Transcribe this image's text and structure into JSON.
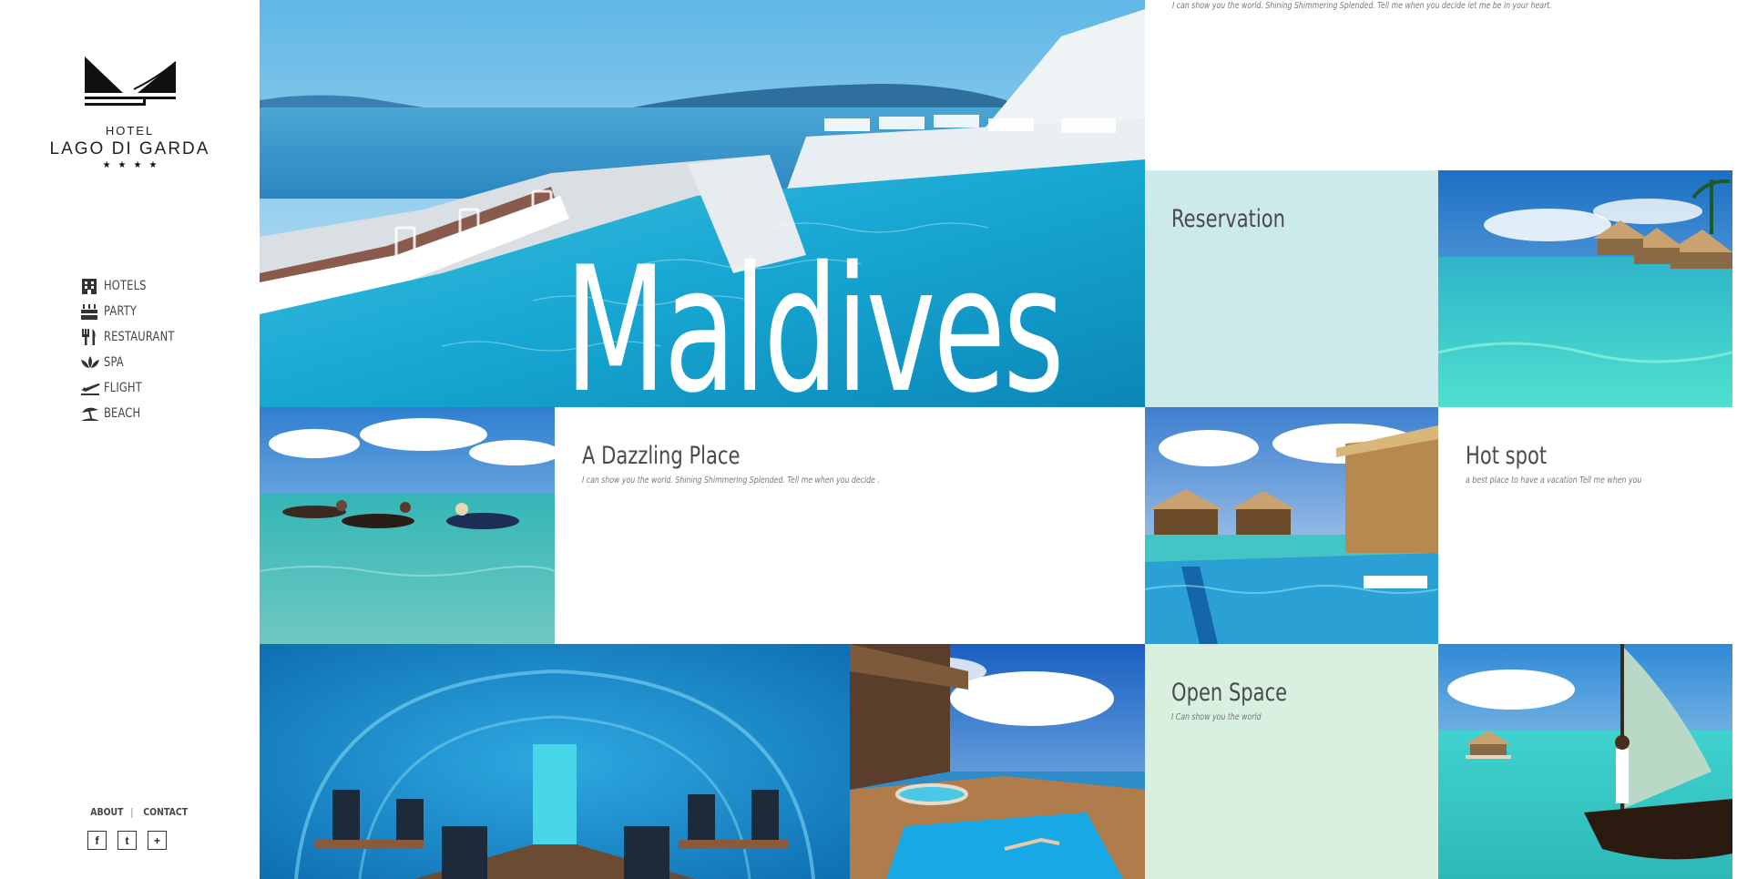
{
  "brand": {
    "line1": "HOTEL",
    "line2": "LAGO DI GARDA",
    "stars": "★★★★"
  },
  "nav": [
    {
      "label": "HOTELS",
      "icon": "building-icon"
    },
    {
      "label": "PARTY",
      "icon": "cake-icon"
    },
    {
      "label": "RESTAURANT",
      "icon": "fork-knife-icon"
    },
    {
      "label": "SPA",
      "icon": "lotus-icon"
    },
    {
      "label": "FLIGHT",
      "icon": "plane-icon"
    },
    {
      "label": "BEACH",
      "icon": "umbrella-icon"
    }
  ],
  "footer": {
    "about": "ABOUT",
    "separator": "|",
    "contact": "CONTACT"
  },
  "social": [
    {
      "glyph": "f",
      "icon": "facebook-icon"
    },
    {
      "glyph": "t",
      "icon": "twitter-icon"
    },
    {
      "glyph": "+",
      "icon": "plus-icon"
    }
  ],
  "hero": {
    "title": "Maldives"
  },
  "top_text": "I can show you the world. Shining Shimmering Splended. Tell me when you decide let me be in your heart.",
  "tiles": {
    "reservation": {
      "title": "Reservation"
    },
    "dazzling": {
      "title": "A Dazzling Place",
      "subtitle": "I can show you the world. Shining Shimmering Splended. Tell me when you decide ."
    },
    "hotspot": {
      "title": "Hot spot",
      "subtitle": "a best place to have a vacation Tell me when you"
    },
    "openspace": {
      "title": "Open Space",
      "subtitle": "I Can show you the world"
    }
  },
  "colors": {
    "reservation_bg": "#cce9ec",
    "openspace_bg": "#d9f0e0",
    "text": "#4a4a4a"
  }
}
